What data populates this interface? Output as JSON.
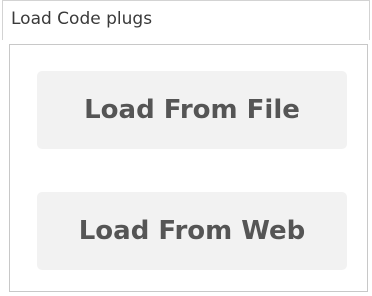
{
  "panel": {
    "title": "Load Code plugs"
  },
  "buttons": {
    "load_from_file": "Load From File",
    "load_from_web": "Load From Web"
  },
  "colors": {
    "button_bg": "#f2f2f2",
    "button_text": "#555555",
    "border": "#c8c8c8"
  }
}
